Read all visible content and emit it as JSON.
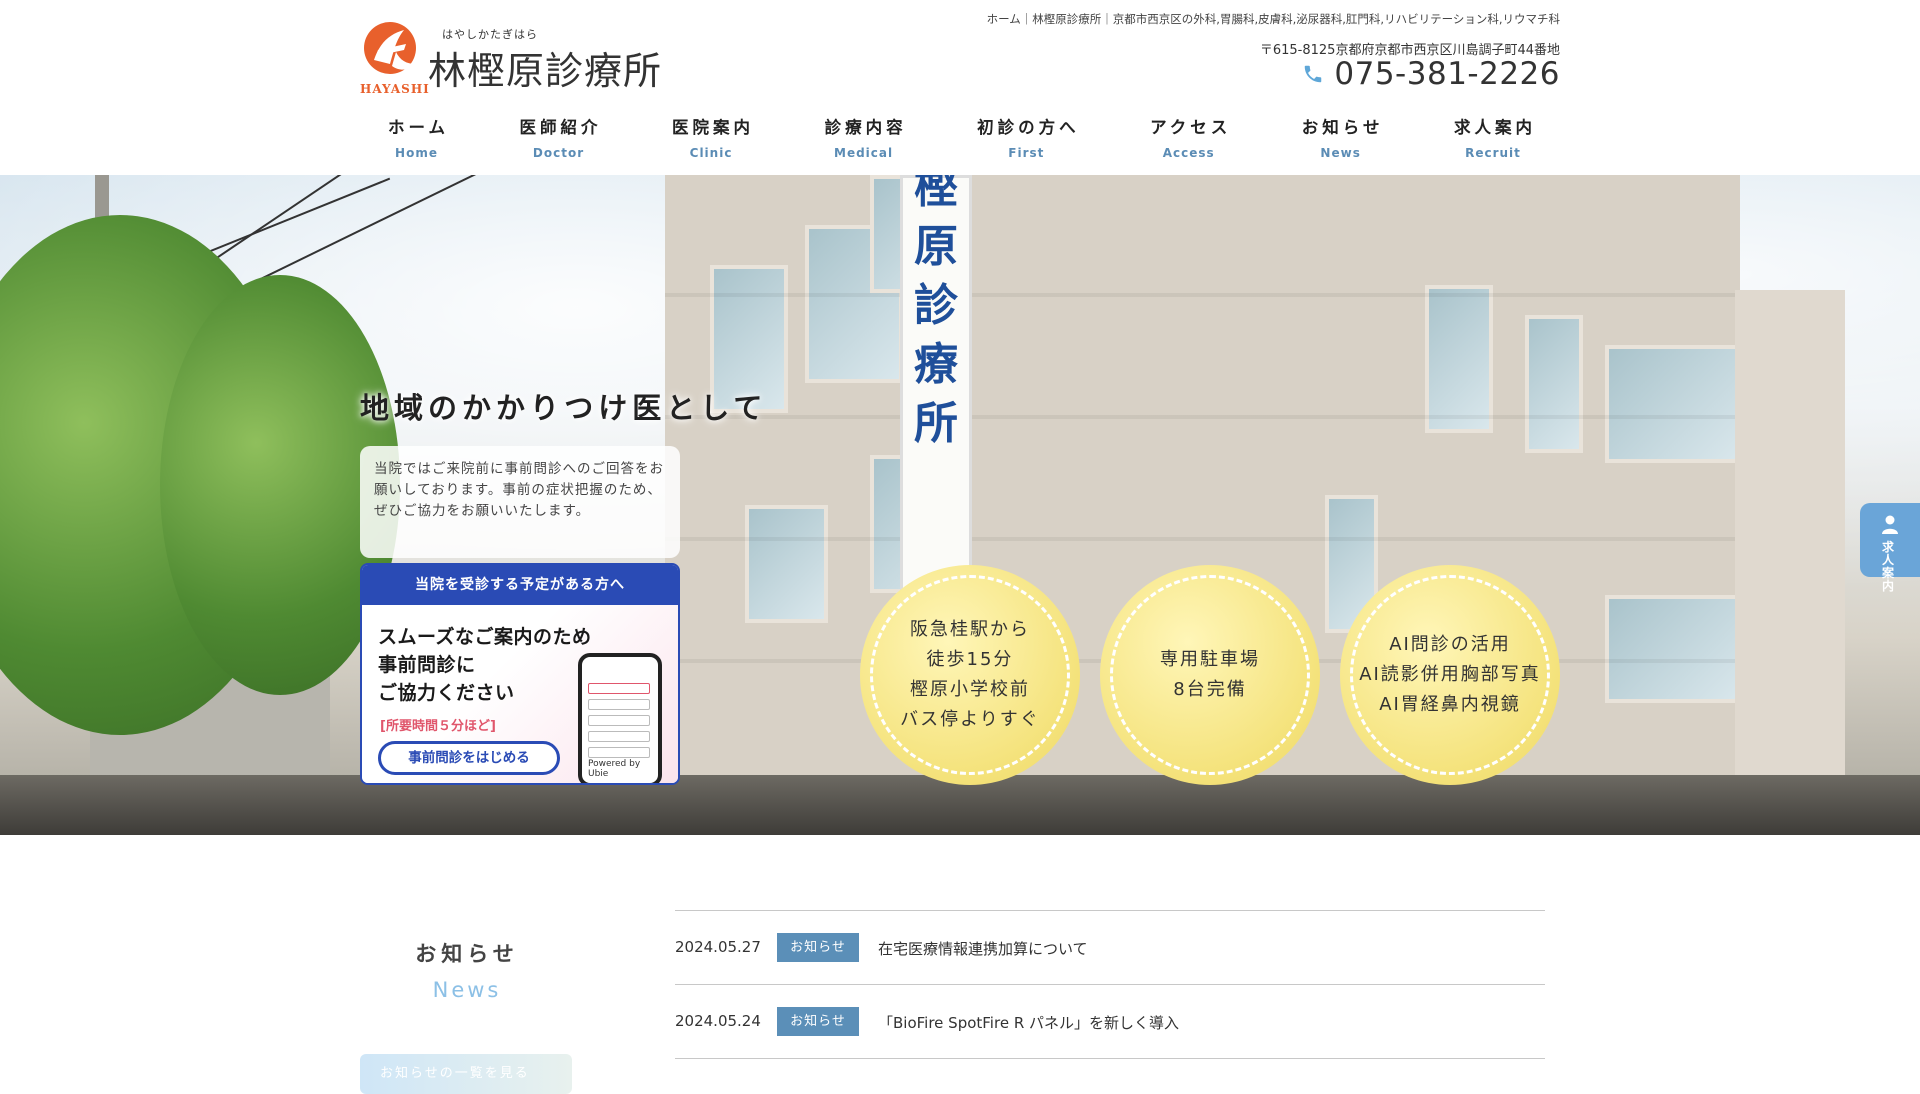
{
  "header": {
    "logo": {
      "ruby": "はやしかたぎはら",
      "name": "林樫原診療所",
      "sub": "HAYASHI"
    },
    "meta": "ホーム｜林樫原診療所｜京都市西京区の外科,胃腸科,皮膚科,泌尿器科,肛門科,リハビリテーション科,リウマチ科",
    "address": "〒615-8125京都府京都市西京区川島調子町44番地",
    "phone": "075-381-2226",
    "colors": {
      "brand_orange": "#e8602c",
      "accent_blue": "#5b8cb5"
    }
  },
  "nav": {
    "items": [
      {
        "jp": "ホーム",
        "en": "Home"
      },
      {
        "jp": "医師紹介",
        "en": "Doctor"
      },
      {
        "jp": "医院案内",
        "en": "Clinic"
      },
      {
        "jp": "診療内容",
        "en": "Medical"
      },
      {
        "jp": "初診の方へ",
        "en": "First"
      },
      {
        "jp": "アクセス",
        "en": "Access"
      },
      {
        "jp": "お知らせ",
        "en": "News"
      },
      {
        "jp": "求人案内",
        "en": "Recruit"
      }
    ]
  },
  "hero": {
    "catch": "地域のかかりつけ医として",
    "sign_text": "樫原診療所",
    "notice": "当院ではご来院前に事前問診へのご回答をお願いしております。事前の症状把握のため、ぜひご協力をお願いいたします。",
    "banner": {
      "head": "当院を受診する予定がある方へ",
      "title_line1": "スムーズなご案内のため",
      "title_line2": "事前問診に",
      "title_line3": "ご協力ください",
      "time": "[所要時間５分ほど]",
      "button": "事前問診をはじめる",
      "credit": "Powered by Ubie",
      "colors": {
        "primary": "#2a4bb5",
        "pink": "#e0566c"
      }
    },
    "badges": [
      {
        "lines": [
          "阪急桂駅から",
          "徒歩15分",
          "樫原小学校前",
          "バス停よりすぐ"
        ]
      },
      {
        "lines": [
          "専用駐車場",
          "8台完備"
        ]
      },
      {
        "lines": [
          "AI問診の活用",
          "AI読影併用胸部写真",
          "AI胃経鼻内視鏡"
        ]
      }
    ],
    "side_tab": {
      "label": "求人案内",
      "icon": "person-icon",
      "color": "#6aa5d8"
    }
  },
  "news": {
    "heading_jp": "お知らせ",
    "heading_en": "News",
    "more_label": "お知らせの一覧を見る",
    "items": [
      {
        "date": "2024.05.27",
        "tag": "お知らせ",
        "title": "在宅医療情報連携加算について"
      },
      {
        "date": "2024.05.24",
        "tag": "お知らせ",
        "title": "「BioFire SpotFire R パネル」を新しく導入"
      }
    ]
  }
}
